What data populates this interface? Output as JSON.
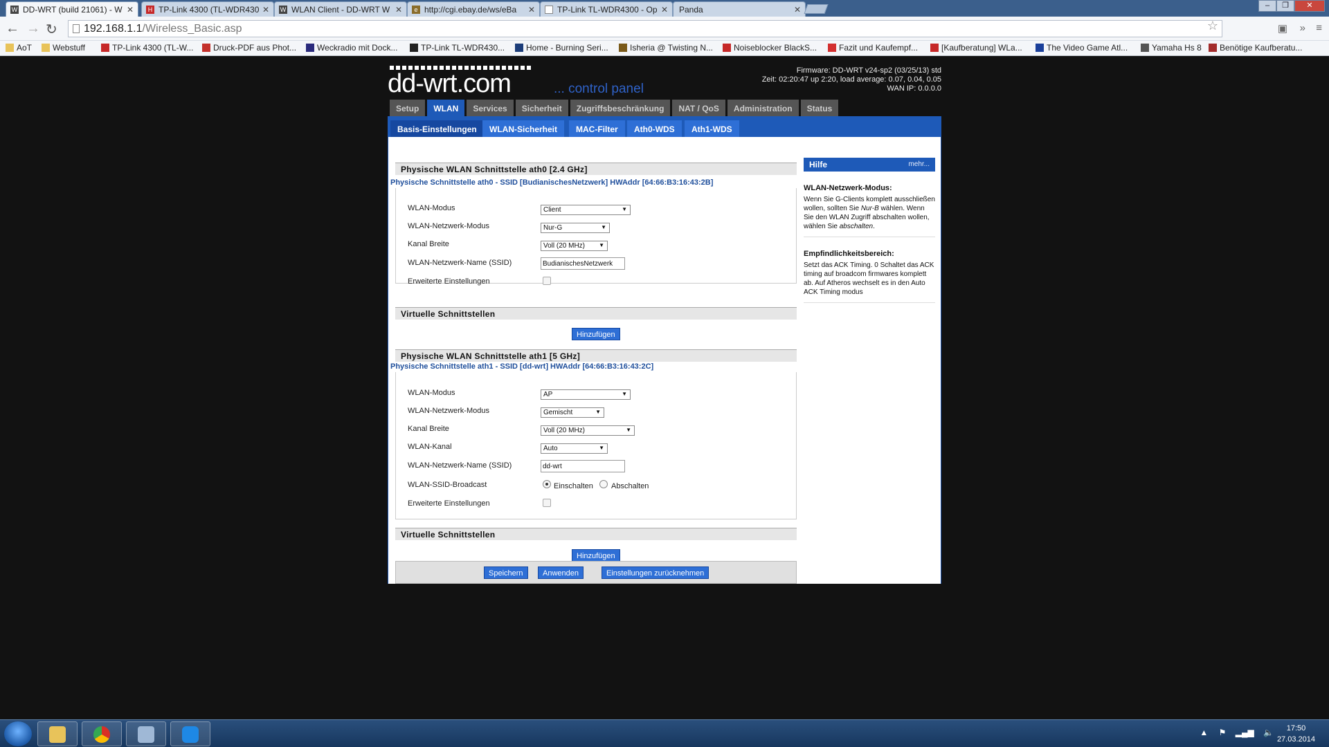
{
  "browser": {
    "tabs": [
      {
        "title": "DD-WRT (build 21061) - W",
        "active": true,
        "icon": "ddwrt-favicon"
      },
      {
        "title": "TP-Link 4300 (TL-WDR430",
        "active": false,
        "icon": "heise-favicon"
      },
      {
        "title": "WLAN Client - DD-WRT W",
        "active": false,
        "icon": "ddwrt-favicon"
      },
      {
        "title": "http://cgi.ebay.de/ws/eBa",
        "active": false,
        "icon": "ebay-favicon"
      },
      {
        "title": "TP-Link TL-WDR4300 - Op",
        "active": false,
        "icon": "page-favicon"
      },
      {
        "title": "Panda",
        "active": false,
        "icon": "none"
      }
    ],
    "url_host": "192.168.1.1",
    "url_path": "/Wireless_Basic.asp",
    "bookmarks": [
      {
        "label": "AoT",
        "icon": "folder-icon"
      },
      {
        "label": "Webstuff",
        "icon": "folder-icon"
      },
      {
        "label": "TP-Link 4300 (TL-W...",
        "icon": "heise-icon"
      },
      {
        "label": "Druck-PDF aus Phot...",
        "icon": "youtube-icon"
      },
      {
        "label": "Weckradio mit Dock...",
        "icon": "shop-icon"
      },
      {
        "label": "TP-Link TL-WDR430...",
        "icon": "amazon-icon"
      },
      {
        "label": "Home - Burning Seri...",
        "icon": "bs-icon"
      },
      {
        "label": "Isheria @ Twisting N...",
        "icon": "wow-icon"
      },
      {
        "label": "Noiseblocker BlackS...",
        "icon": "a-icon"
      },
      {
        "label": "Fazit und Kaufempf...",
        "icon": "t-icon"
      },
      {
        "label": "[Kaufberatung] WLa...",
        "icon": "heise-icon"
      },
      {
        "label": "The Video Game Atl...",
        "icon": "globe-icon"
      },
      {
        "label": "Yamaha Hs 8",
        "icon": "bottle-icon"
      },
      {
        "label": "Benötige Kaufberatu...",
        "icon": "forum-icon"
      }
    ]
  },
  "header": {
    "logo": "dd-wrt.com",
    "logo_sub": "... control panel",
    "firmware": "Firmware: DD-WRT v24-sp2 (03/25/13) std",
    "time": "Zeit: 02:20:47 up 2:20, load average: 0.07, 0.04, 0.05",
    "wan_ip": "WAN IP: 0.0.0.0"
  },
  "mainnav": [
    "Setup",
    "WLAN",
    "Services",
    "Sicherheit",
    "Zugriffsbeschränkung",
    "NAT / QoS",
    "Administration",
    "Status"
  ],
  "mainnav_active": "WLAN",
  "subnav": [
    "Basis-Einstellungen",
    "WLAN-Sicherheit",
    "MAC-Filter",
    "Ath0-WDS",
    "Ath1-WDS"
  ],
  "ath0": {
    "section_title": "Physische WLAN Schnittstelle ath0 [2.4 GHz]",
    "iface_title": "Physische Schnittstelle ath0 - SSID [BudianischesNetzwerk] HWAddr [64:66:B3:16:43:2B]",
    "fields": {
      "mode_label": "WLAN-Modus",
      "mode_value": "Client",
      "netmode_label": "WLAN-Netzwerk-Modus",
      "netmode_value": "Nur-G",
      "width_label": "Kanal Breite",
      "width_value": "Voll (20 MHz)",
      "ssid_label": "WLAN-Netzwerk-Name (SSID)",
      "ssid_value": "BudianischesNetzwerk",
      "advanced_label": "Erweiterte Einstellungen"
    }
  },
  "virtual_title": "Virtuelle Schnittstellen",
  "add_button": "Hinzufügen",
  "ath1": {
    "section_title": "Physische WLAN Schnittstelle ath1 [5 GHz]",
    "iface_title": "Physische Schnittstelle ath1 - SSID [dd-wrt] HWAddr [64:66:B3:16:43:2C]",
    "fields": {
      "mode_label": "WLAN-Modus",
      "mode_value": "AP",
      "netmode_label": "WLAN-Netzwerk-Modus",
      "netmode_value": "Gemischt",
      "width_label": "Kanal Breite",
      "width_value": "Voll (20 MHz)",
      "channel_label": "WLAN-Kanal",
      "channel_value": "Auto",
      "ssid_label": "WLAN-Netzwerk-Name (SSID)",
      "ssid_value": "dd-wrt",
      "broadcast_label": "WLAN-SSID-Broadcast",
      "broadcast_on": "Einschalten",
      "broadcast_off": "Abschalten",
      "advanced_label": "Erweiterte Einstellungen"
    }
  },
  "footer_buttons": {
    "save": "Speichern",
    "apply": "Anwenden",
    "reset": "Einstellungen zurücknehmen"
  },
  "help": {
    "title": "Hilfe",
    "more": "mehr...",
    "section1_title": "WLAN-Netzwerk-Modus:",
    "section1_a": "Wenn Sie G-Clients komplett ausschließen wollen, sollten Sie ",
    "section1_em1": "Nur-B",
    "section1_b": " wählen. Wenn Sie den WLAN Zugriff abschalten wollen, wählen Sie ",
    "section1_em2": "abschalten",
    "section1_c": ".",
    "section2_title": "Empfindlichkeitsbereich:",
    "section2_text": "Setzt das ACK Timing. 0 Schaltet das ACK timing auf broadcom firmwares komplett ab. Auf Atheros wechselt es in den Auto ACK Timing modus"
  },
  "taskbar": {
    "time": "17:50",
    "date": "27.03.2014"
  }
}
